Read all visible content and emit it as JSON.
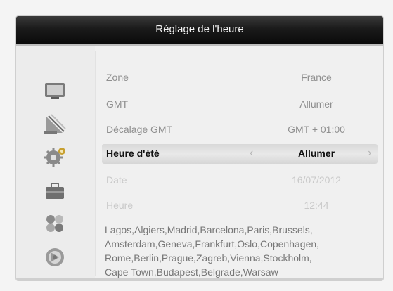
{
  "title": "Réglage de l'heure",
  "rows": [
    {
      "label": "Zone",
      "value": "France"
    },
    {
      "label": "GMT",
      "value": "Allumer"
    },
    {
      "label": "Décalage GMT",
      "value": "GMT + 01:00"
    },
    {
      "label": "Heure d'été",
      "value": "Allumer"
    },
    {
      "label": "Date",
      "value": "16/07/2012"
    },
    {
      "label": "Heure",
      "value": "12:44"
    }
  ],
  "cities": [
    "Lagos,Algiers,Madrid,Barcelona,Paris,Brussels,",
    "Amsterdam,Geneva,Frankfurt,Oslo,Copenhagen,",
    "Rome,Berlin,Prague,Zagreb,Vienna,Stockholm,",
    "Cape Town,Budapest,Belgrade,Warsaw"
  ],
  "arrows": {
    "left": "‹",
    "right": "›"
  },
  "sidebar_icons": [
    "tv-icon",
    "satellite-icon",
    "settings-icon",
    "toolbox-icon",
    "apps-icon",
    "media-icon"
  ]
}
